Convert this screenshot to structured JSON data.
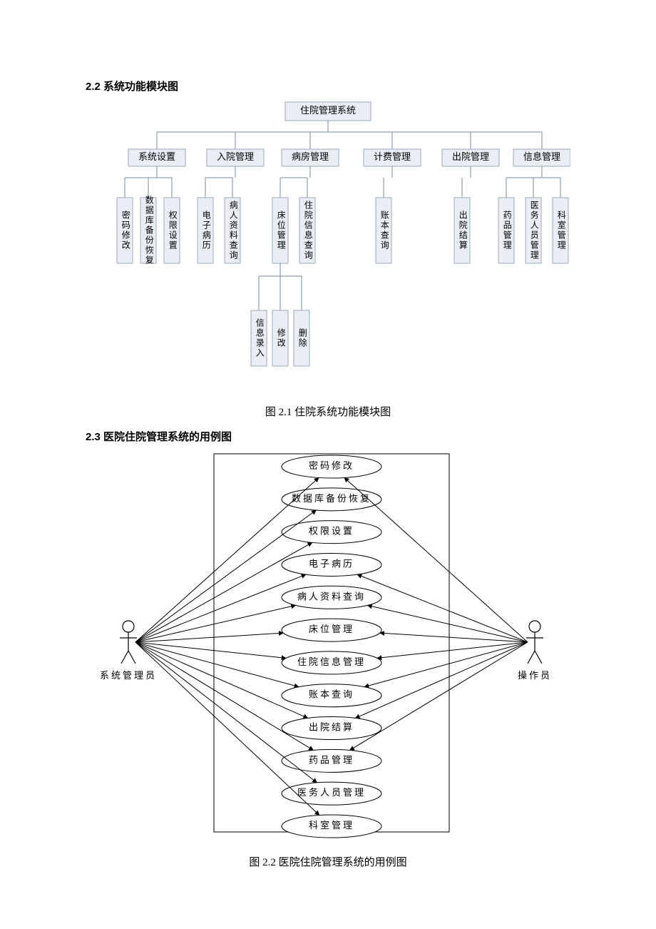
{
  "section22_title": "2.2 系统功能模块图",
  "section23_title": "2.3 医院住院管理系统的用例图",
  "caption21": "图 2.1 住院系统功能模块图",
  "caption22": "图 2.2 医院住院管理系统的用例图",
  "hierarchy": {
    "root": "住院管理系统",
    "level2": [
      "系统设置",
      "入院管理",
      "病房管理",
      "计费管理",
      "出院管理",
      "信息管理"
    ],
    "level3": {
      "0": [
        "密码修改",
        "数据库备份恢复",
        "权限设置"
      ],
      "1": [
        "电子病历",
        "病人资料查询"
      ],
      "2": [
        "床位管理",
        "住院信息查询"
      ],
      "3": [
        "账本查询"
      ],
      "4": [
        "出院结算"
      ],
      "5": [
        "药品管理",
        "医务人员管理",
        "科室管理"
      ]
    },
    "level4_parent": "床位管理",
    "level4": [
      "信息录入",
      "修改",
      "删除"
    ]
  },
  "usecase": {
    "actors": {
      "left": "系统管理员",
      "right": "操作员"
    },
    "cases": [
      "密码修改",
      "数据库备份恢复",
      "权限设置",
      "电子病历",
      "病人资料查询",
      "床位管理",
      "住院信息管理",
      "账本查询",
      "出院结算",
      "药品管理",
      "医务人员管理",
      "科室管理"
    ],
    "left_links": [
      0,
      1,
      2,
      3,
      4,
      5,
      6,
      7,
      8,
      9,
      10,
      11
    ],
    "right_links": [
      0,
      3,
      4,
      5,
      6,
      7,
      8,
      9
    ]
  }
}
